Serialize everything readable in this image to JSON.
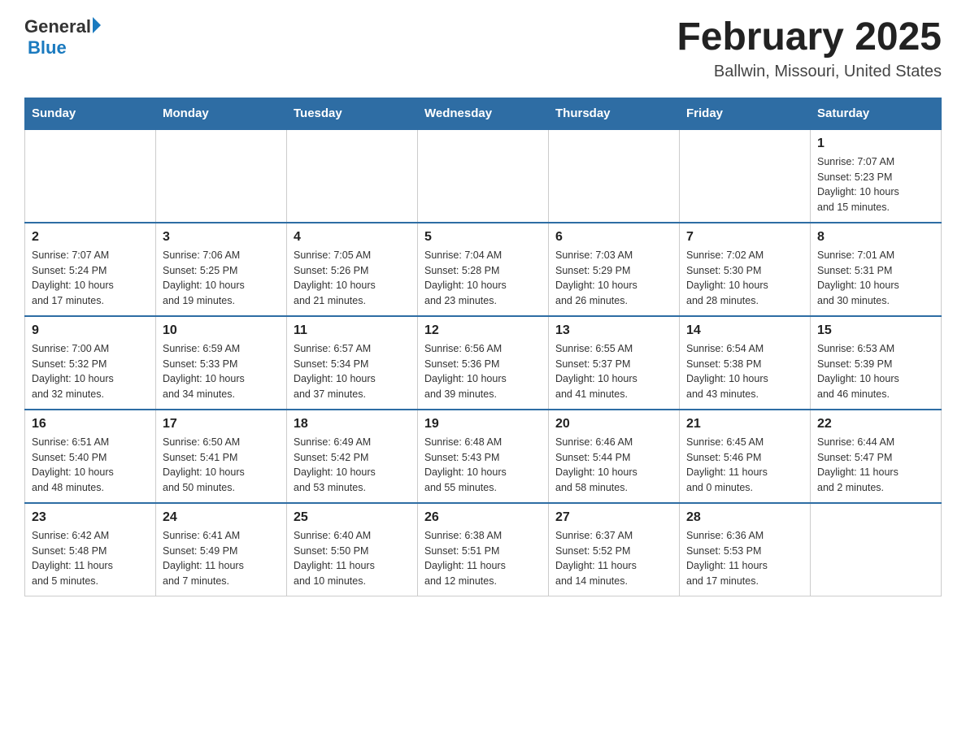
{
  "logo": {
    "general": "General",
    "blue": "Blue"
  },
  "title": "February 2025",
  "location": "Ballwin, Missouri, United States",
  "days_of_week": [
    "Sunday",
    "Monday",
    "Tuesday",
    "Wednesday",
    "Thursday",
    "Friday",
    "Saturday"
  ],
  "weeks": [
    [
      {
        "day": "",
        "info": ""
      },
      {
        "day": "",
        "info": ""
      },
      {
        "day": "",
        "info": ""
      },
      {
        "day": "",
        "info": ""
      },
      {
        "day": "",
        "info": ""
      },
      {
        "day": "",
        "info": ""
      },
      {
        "day": "1",
        "info": "Sunrise: 7:07 AM\nSunset: 5:23 PM\nDaylight: 10 hours\nand 15 minutes."
      }
    ],
    [
      {
        "day": "2",
        "info": "Sunrise: 7:07 AM\nSunset: 5:24 PM\nDaylight: 10 hours\nand 17 minutes."
      },
      {
        "day": "3",
        "info": "Sunrise: 7:06 AM\nSunset: 5:25 PM\nDaylight: 10 hours\nand 19 minutes."
      },
      {
        "day": "4",
        "info": "Sunrise: 7:05 AM\nSunset: 5:26 PM\nDaylight: 10 hours\nand 21 minutes."
      },
      {
        "day": "5",
        "info": "Sunrise: 7:04 AM\nSunset: 5:28 PM\nDaylight: 10 hours\nand 23 minutes."
      },
      {
        "day": "6",
        "info": "Sunrise: 7:03 AM\nSunset: 5:29 PM\nDaylight: 10 hours\nand 26 minutes."
      },
      {
        "day": "7",
        "info": "Sunrise: 7:02 AM\nSunset: 5:30 PM\nDaylight: 10 hours\nand 28 minutes."
      },
      {
        "day": "8",
        "info": "Sunrise: 7:01 AM\nSunset: 5:31 PM\nDaylight: 10 hours\nand 30 minutes."
      }
    ],
    [
      {
        "day": "9",
        "info": "Sunrise: 7:00 AM\nSunset: 5:32 PM\nDaylight: 10 hours\nand 32 minutes."
      },
      {
        "day": "10",
        "info": "Sunrise: 6:59 AM\nSunset: 5:33 PM\nDaylight: 10 hours\nand 34 minutes."
      },
      {
        "day": "11",
        "info": "Sunrise: 6:57 AM\nSunset: 5:34 PM\nDaylight: 10 hours\nand 37 minutes."
      },
      {
        "day": "12",
        "info": "Sunrise: 6:56 AM\nSunset: 5:36 PM\nDaylight: 10 hours\nand 39 minutes."
      },
      {
        "day": "13",
        "info": "Sunrise: 6:55 AM\nSunset: 5:37 PM\nDaylight: 10 hours\nand 41 minutes."
      },
      {
        "day": "14",
        "info": "Sunrise: 6:54 AM\nSunset: 5:38 PM\nDaylight: 10 hours\nand 43 minutes."
      },
      {
        "day": "15",
        "info": "Sunrise: 6:53 AM\nSunset: 5:39 PM\nDaylight: 10 hours\nand 46 minutes."
      }
    ],
    [
      {
        "day": "16",
        "info": "Sunrise: 6:51 AM\nSunset: 5:40 PM\nDaylight: 10 hours\nand 48 minutes."
      },
      {
        "day": "17",
        "info": "Sunrise: 6:50 AM\nSunset: 5:41 PM\nDaylight: 10 hours\nand 50 minutes."
      },
      {
        "day": "18",
        "info": "Sunrise: 6:49 AM\nSunset: 5:42 PM\nDaylight: 10 hours\nand 53 minutes."
      },
      {
        "day": "19",
        "info": "Sunrise: 6:48 AM\nSunset: 5:43 PM\nDaylight: 10 hours\nand 55 minutes."
      },
      {
        "day": "20",
        "info": "Sunrise: 6:46 AM\nSunset: 5:44 PM\nDaylight: 10 hours\nand 58 minutes."
      },
      {
        "day": "21",
        "info": "Sunrise: 6:45 AM\nSunset: 5:46 PM\nDaylight: 11 hours\nand 0 minutes."
      },
      {
        "day": "22",
        "info": "Sunrise: 6:44 AM\nSunset: 5:47 PM\nDaylight: 11 hours\nand 2 minutes."
      }
    ],
    [
      {
        "day": "23",
        "info": "Sunrise: 6:42 AM\nSunset: 5:48 PM\nDaylight: 11 hours\nand 5 minutes."
      },
      {
        "day": "24",
        "info": "Sunrise: 6:41 AM\nSunset: 5:49 PM\nDaylight: 11 hours\nand 7 minutes."
      },
      {
        "day": "25",
        "info": "Sunrise: 6:40 AM\nSunset: 5:50 PM\nDaylight: 11 hours\nand 10 minutes."
      },
      {
        "day": "26",
        "info": "Sunrise: 6:38 AM\nSunset: 5:51 PM\nDaylight: 11 hours\nand 12 minutes."
      },
      {
        "day": "27",
        "info": "Sunrise: 6:37 AM\nSunset: 5:52 PM\nDaylight: 11 hours\nand 14 minutes."
      },
      {
        "day": "28",
        "info": "Sunrise: 6:36 AM\nSunset: 5:53 PM\nDaylight: 11 hours\nand 17 minutes."
      },
      {
        "day": "",
        "info": ""
      }
    ]
  ]
}
